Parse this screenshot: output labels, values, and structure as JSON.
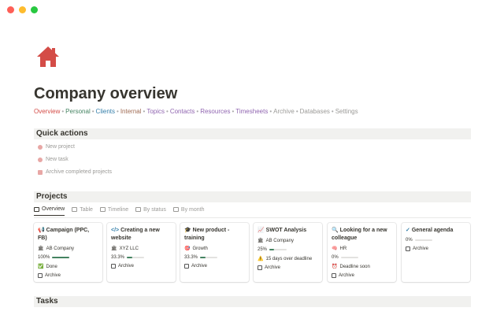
{
  "window": {
    "controls": [
      "#fe5f57",
      "#febc2e",
      "#28c840"
    ]
  },
  "page": {
    "icon": "house-icon",
    "title": "Company overview"
  },
  "nav": [
    {
      "label": "Overview",
      "color": "#d44c47"
    },
    {
      "label": "Personal",
      "color": "#448361"
    },
    {
      "label": "Clients",
      "color": "#337ea9"
    },
    {
      "label": "Internal",
      "color": "#9f6b53"
    },
    {
      "label": "Topics",
      "color": "#9065b0"
    },
    {
      "label": "Contacts",
      "color": "#9065b0"
    },
    {
      "label": "Resources",
      "color": "#9065b0"
    },
    {
      "label": "Timesheets",
      "color": "#9065b0"
    },
    {
      "label": "Archive",
      "color": "#9b9a97"
    },
    {
      "label": "Databases",
      "color": "#9b9a97"
    },
    {
      "label": "Settings",
      "color": "#9b9a97"
    }
  ],
  "quick_actions": {
    "title": "Quick actions",
    "items": [
      {
        "label": "New project",
        "icon": "plus-icon"
      },
      {
        "label": "New task",
        "icon": "check-icon"
      },
      {
        "label": "Archive completed projects",
        "icon": "archive-icon"
      }
    ]
  },
  "projects": {
    "title": "Projects",
    "tabs": [
      {
        "label": "Overview",
        "icon": "gallery-icon"
      },
      {
        "label": "Table",
        "icon": "table-icon"
      },
      {
        "label": "Timeline",
        "icon": "timeline-icon"
      },
      {
        "label": "By status",
        "icon": "board-icon"
      },
      {
        "label": "By month",
        "icon": "board-icon"
      }
    ],
    "cards": [
      {
        "icon": "📢",
        "title": "Campaign (PPC, FB)",
        "tag_icon": "🏛",
        "tag": "AB Company",
        "progress_label": "100%",
        "progress": 1.0,
        "status_icon": "✅",
        "status": "Done",
        "archive": "Archive"
      },
      {
        "icon": "</>",
        "title": "Creating a new website",
        "tag_icon": "🏛",
        "tag": "XYZ LLC",
        "progress_label": "33.3%",
        "progress": 0.333,
        "archive": "Archive"
      },
      {
        "icon": "🎓",
        "title": "New product - training",
        "tag_icon": "🎯",
        "tag": "Growth",
        "progress_label": "33.3%",
        "progress": 0.333,
        "archive": "Archive"
      },
      {
        "icon": "📈",
        "title": "SWOT Analysis",
        "tag_icon": "🏛",
        "tag": "AB Company",
        "progress_label": "25%",
        "progress": 0.25,
        "status_icon": "⚠️",
        "status": "15 days over deadline",
        "archive": "Archive"
      },
      {
        "icon": "🔍",
        "title": "Looking for a new colleague",
        "tag_icon": "🧠",
        "tag": "HR",
        "progress_label": "0%",
        "progress": 0,
        "status_icon": "⏰",
        "status": "Deadline soon",
        "archive": "Archive"
      },
      {
        "icon": "✓",
        "title": "General agenda",
        "progress_label": "0%",
        "progress": 0,
        "archive": "Archive"
      }
    ]
  },
  "tasks": {
    "title": "Tasks"
  }
}
